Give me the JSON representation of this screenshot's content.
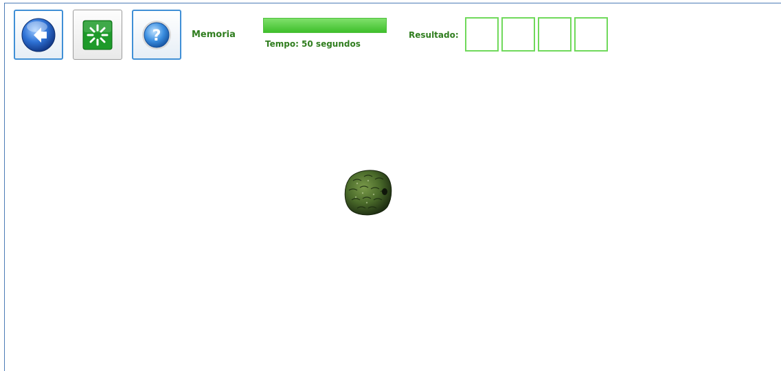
{
  "toolbar": {
    "back_icon": "back-arrow-icon",
    "restart_icon": "restart-spinner-icon",
    "help_icon": "help-question-icon"
  },
  "game": {
    "title": "Memoria",
    "timer": {
      "label": "Tempo: 50 segundos",
      "fraction_remaining": 1.0
    },
    "result": {
      "label": "Resultado:",
      "slots": [
        "",
        "",
        "",
        ""
      ]
    },
    "item": {
      "icon": "custard-apple-fruit"
    }
  },
  "colors": {
    "accent_green": "#2f7d1e",
    "bar_green": "#4cbf3a",
    "slot_border": "#6fd95a",
    "frame_blue": "#4a7ab5"
  }
}
